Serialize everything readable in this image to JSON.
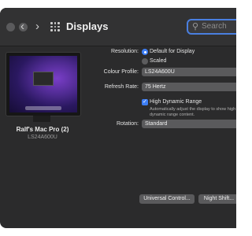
{
  "window": {
    "title": "Displays",
    "back_icon": "chevron-left-icon",
    "forward_icon": "chevron-right-icon",
    "grid_icon": "grid-icon"
  },
  "search": {
    "placeholder": "Search",
    "icon": "search-icon"
  },
  "display": {
    "name": "Ralf's Mac Pro (2)",
    "model": "LS24A600U"
  },
  "settings": {
    "resolution_label": "Resolution:",
    "resolution_options": [
      "Default for Display",
      "Scaled"
    ],
    "resolution_selected": "Default for Display",
    "colour_profile_label": "Colour Profile:",
    "colour_profile_value": "LS24A600U",
    "refresh_rate_label": "Refresh Rate:",
    "refresh_rate_value": "75 Hertz",
    "hdr_label": "High Dynamic Range",
    "hdr_checked": true,
    "hdr_description": "Automatically adjust the display to show high dynamic range content.",
    "rotation_label": "Rotation:",
    "rotation_value": "Standard"
  },
  "buttons": {
    "universal_control": "Universal Control...",
    "night_shift": "Night Shift..."
  },
  "colors": {
    "accent": "#3d7ef6",
    "window_bg": "#2b2b2c"
  }
}
